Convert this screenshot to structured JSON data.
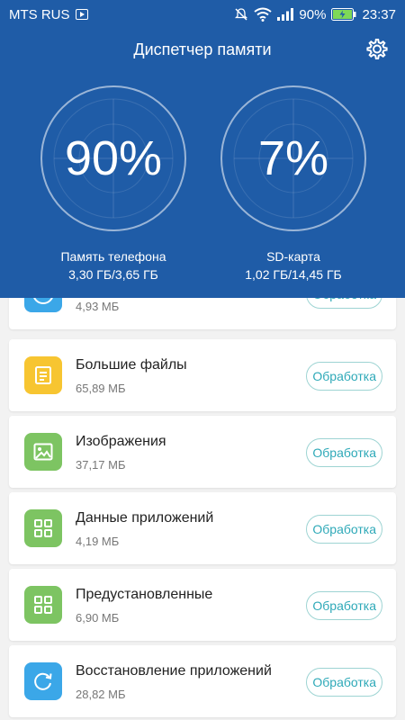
{
  "status": {
    "carrier": "MTS RUS",
    "battery": "90%",
    "time": "23:37"
  },
  "header": {
    "title": "Диспетчер памяти"
  },
  "gauges": {
    "phone": {
      "percent": "90%",
      "label": "Память телефона",
      "value": "3,30 ГБ/3,65 ГБ"
    },
    "sd": {
      "percent": "7%",
      "label": "SD-карта",
      "value": "1,02 ГБ/14,45 ГБ"
    }
  },
  "items": [
    {
      "name": "",
      "size": "4,93 МБ",
      "button": "Обработка",
      "icon": "play-icon",
      "color": "#3ba7e8"
    },
    {
      "name": "Большие файлы",
      "size": "65,89 МБ",
      "button": "Обработка",
      "icon": "document-icon",
      "color": "#f7c531"
    },
    {
      "name": "Изображения",
      "size": "37,17 МБ",
      "button": "Обработка",
      "icon": "image-icon",
      "color": "#7dc462"
    },
    {
      "name": "Данные приложений",
      "size": "4,19 МБ",
      "button": "Обработка",
      "icon": "grid-icon",
      "color": "#7dc462"
    },
    {
      "name": "Предустановленные",
      "size": "6,90 МБ",
      "button": "Обработка",
      "icon": "grid-icon",
      "color": "#7dc462"
    },
    {
      "name": "Восстановление приложений",
      "size": "28,82 МБ",
      "button": "Обработка",
      "icon": "restore-icon",
      "color": "#3ba7e8"
    }
  ]
}
